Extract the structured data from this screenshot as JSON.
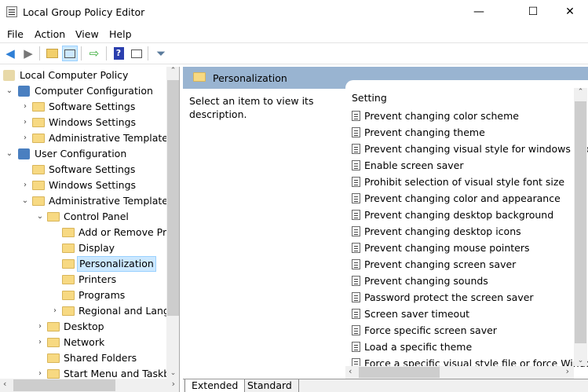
{
  "window": {
    "title": "Local Group Policy Editor",
    "minimize": "—",
    "maximize": "☐",
    "close": "✕"
  },
  "menu": [
    "File",
    "Action",
    "View",
    "Help"
  ],
  "toolbar": [
    "back-icon",
    "forward-icon",
    "up-folder-icon",
    "show-hide-tree-icon",
    "export-list-icon",
    "help-icon",
    "show-hide-action-pane-icon",
    "filter-icon"
  ],
  "tree": [
    {
      "label": "Local Computer Policy",
      "level": 0,
      "icon": "policy-scroll-icon",
      "chev": ""
    },
    {
      "label": "Computer Configuration",
      "level": 0,
      "icon": "computer-icon",
      "chev": "⌄"
    },
    {
      "label": "Software Settings",
      "level": 1,
      "icon": "folder-icon",
      "chev": "›"
    },
    {
      "label": "Windows Settings",
      "level": 1,
      "icon": "folder-icon",
      "chev": "›"
    },
    {
      "label": "Administrative Templates",
      "level": 1,
      "icon": "folder-icon",
      "chev": "›"
    },
    {
      "label": "User Configuration",
      "level": 0,
      "icon": "user-icon",
      "chev": "⌄"
    },
    {
      "label": "Software Settings",
      "level": 1,
      "icon": "folder-icon",
      "chev": ""
    },
    {
      "label": "Windows Settings",
      "level": 1,
      "icon": "folder-icon",
      "chev": "›"
    },
    {
      "label": "Administrative Templates",
      "level": 1,
      "icon": "folder-icon",
      "chev": "⌄"
    },
    {
      "label": "Control Panel",
      "level": 2,
      "icon": "folder-icon",
      "chev": "⌄"
    },
    {
      "label": "Add or Remove Programs",
      "level": 3,
      "icon": "folder-icon",
      "chev": ""
    },
    {
      "label": "Display",
      "level": 3,
      "icon": "folder-icon",
      "chev": ""
    },
    {
      "label": "Personalization",
      "level": 3,
      "icon": "folder-icon",
      "chev": "",
      "selected": true
    },
    {
      "label": "Printers",
      "level": 3,
      "icon": "folder-icon",
      "chev": ""
    },
    {
      "label": "Programs",
      "level": 3,
      "icon": "folder-icon",
      "chev": ""
    },
    {
      "label": "Regional and Language Options",
      "level": 3,
      "icon": "folder-icon",
      "chev": "›"
    },
    {
      "label": "Desktop",
      "level": 2,
      "icon": "folder-icon",
      "chev": "›"
    },
    {
      "label": "Network",
      "level": 2,
      "icon": "folder-icon",
      "chev": "›"
    },
    {
      "label": "Shared Folders",
      "level": 2,
      "icon": "folder-icon",
      "chev": ""
    },
    {
      "label": "Start Menu and Taskbar",
      "level": 2,
      "icon": "folder-icon",
      "chev": "›"
    }
  ],
  "header": {
    "title": "Personalization"
  },
  "description": "Select an item to view its description.",
  "settings": {
    "column": "Setting",
    "items": [
      "Prevent changing color scheme",
      "Prevent changing theme",
      "Prevent changing visual style for windows and buttons",
      "Enable screen saver",
      "Prohibit selection of visual style font size",
      "Prevent changing color and appearance",
      "Prevent changing desktop background",
      "Prevent changing desktop icons",
      "Prevent changing mouse pointers",
      "Prevent changing screen saver",
      "Prevent changing sounds",
      "Password protect the screen saver",
      "Screen saver timeout",
      "Force specific screen saver",
      "Load a specific theme",
      "Force a specific visual style file or force Windows Classic"
    ]
  },
  "tabs": [
    "Extended",
    "Standard"
  ],
  "colors": {
    "header": "#99b4d1",
    "selection": "#cce8ff"
  }
}
